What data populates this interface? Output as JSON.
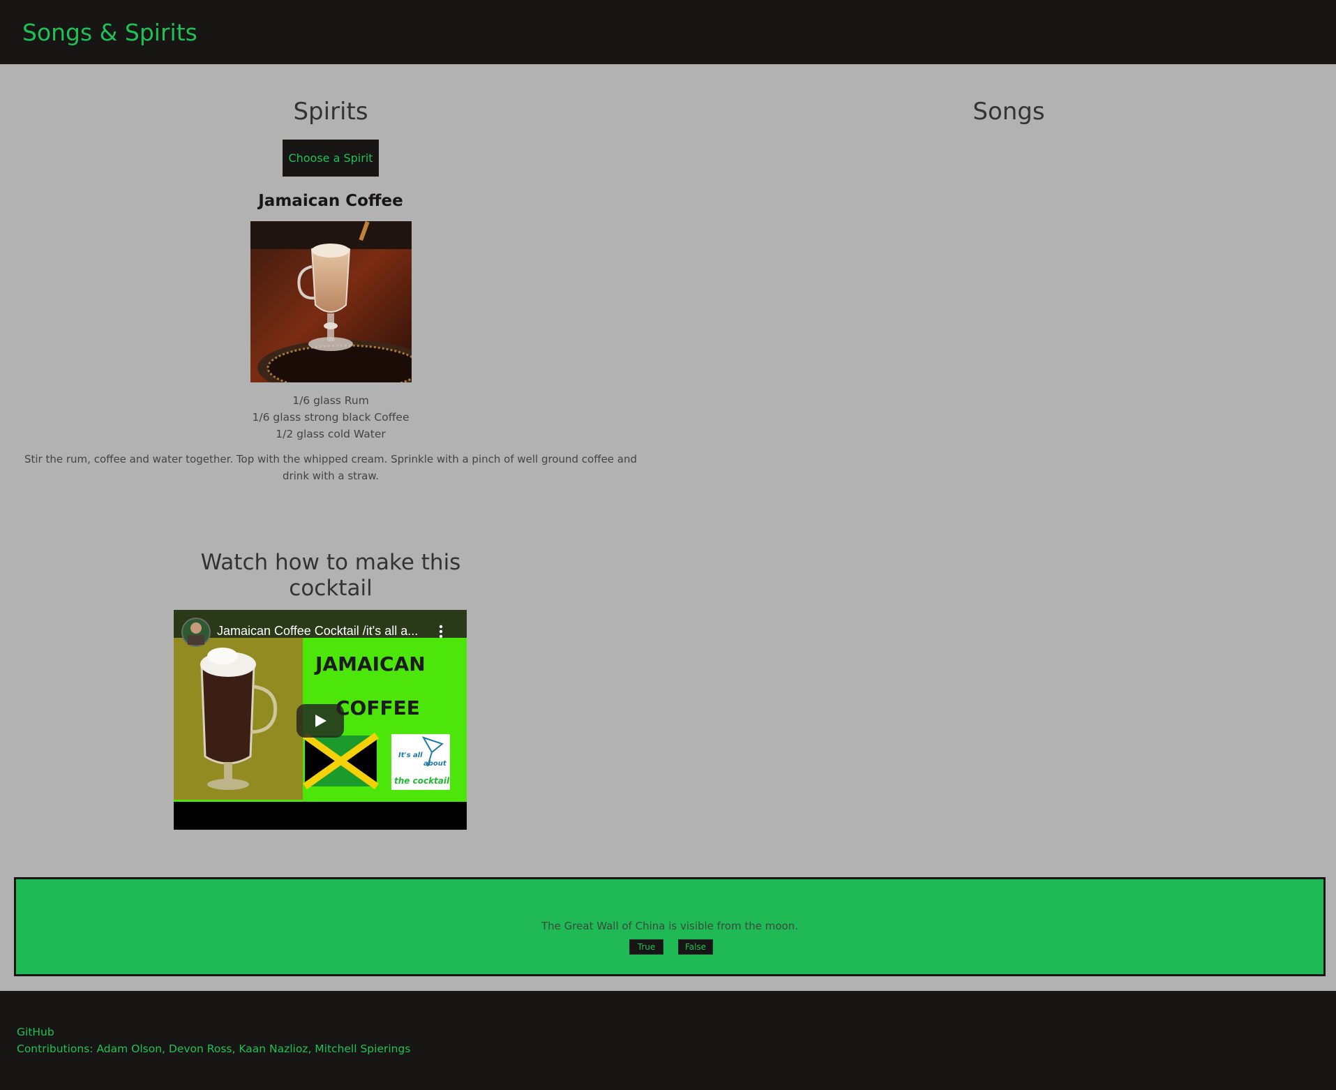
{
  "header": {
    "brand": "Songs & Spirits"
  },
  "spirits": {
    "heading": "Spirits",
    "choose_button": "Choose a Spirit",
    "drink_name": "Jamaican Coffee",
    "ingredients": [
      "1/6 glass Rum",
      "1/6 glass strong black Coffee",
      "1/2 glass cold Water"
    ],
    "instructions": "Stir the rum, coffee and water together. Top with the whipped cream. Sprinkle with a pinch of well ground coffee and drink with a straw.",
    "watch_heading": "Watch how to make this cocktail",
    "video": {
      "title": "Jamaican Coffee Cocktail /it's all a...",
      "thumb_line1": "JAMAICAN",
      "thumb_line2": "COFFEE",
      "badge_line1": "It's all",
      "badge_line2": "about",
      "badge_line3": "the cocktail"
    }
  },
  "songs": {
    "heading": "Songs"
  },
  "trivia": {
    "question": "The Great Wall of China is visible from the moon.",
    "true_label": "True",
    "false_label": "False"
  },
  "footer": {
    "github_link": "GitHub",
    "contributions": "Contributions: Adam Olson, Devon Ross, Kaan Nazlioz, Mitchell Spierings"
  },
  "colors": {
    "accent": "#1fc155",
    "dark": "#181515",
    "page_bg": "#b2b2b2",
    "trivia_bg": "#1fba56"
  }
}
